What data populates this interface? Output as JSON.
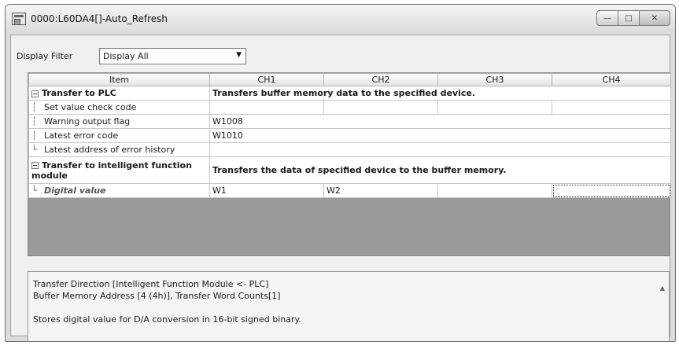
{
  "window": {
    "title": "0000:L60DA4[]-Auto_Refresh",
    "minimize_glyph": "—",
    "maximize_glyph": "□",
    "close_glyph": "✕"
  },
  "filter": {
    "label": "Display Filter",
    "selected": "Display All",
    "arrow": "▼"
  },
  "grid": {
    "headers": [
      "Item",
      "CH1",
      "CH2",
      "CH3",
      "CH4"
    ],
    "rows": [
      {
        "item": "Transfer to PLC",
        "span_text": "Transfers buffer memory data to the specified device."
      },
      {
        "item": "Set value check code",
        "ch1": "",
        "ch2": "",
        "ch3": "",
        "ch4": ""
      },
      {
        "item": "Warning output flag",
        "span_value": "W1008"
      },
      {
        "item": "Latest error code",
        "span_value": "W1010"
      },
      {
        "item": "Latest address of error history",
        "span_value": ""
      },
      {
        "item": "Transfer to intelligent function module",
        "span_text": "Transfers the data of specified device to the buffer memory."
      },
      {
        "item": "Digital value",
        "ch1": "W1",
        "ch2": "W2",
        "ch3": "",
        "ch4": ""
      }
    ]
  },
  "description": {
    "line1": "Transfer Direction [Intelligent Function Module <- PLC]",
    "line2": "Buffer Memory Address [4 (4h)], Transfer Word Counts[1]",
    "line3": "Stores digital value for D/A conversion in 16-bit signed binary."
  },
  "colors": {
    "empty_grid_area": "#9a9a9a"
  }
}
